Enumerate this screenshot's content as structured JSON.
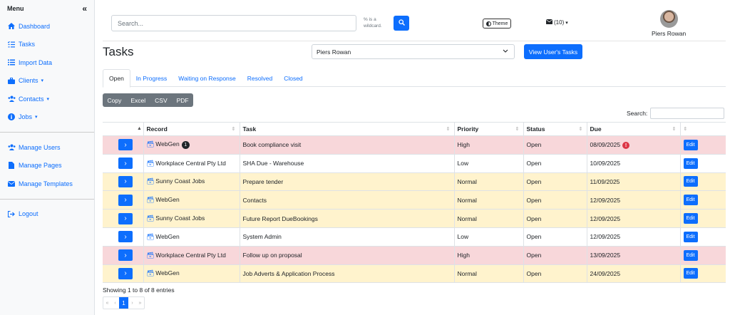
{
  "sidebar": {
    "title": "Menu",
    "collapse_icon": "«",
    "items": [
      {
        "label": "Dashboard",
        "icon": "home-icon"
      },
      {
        "label": "Tasks",
        "icon": "list-check-icon"
      },
      {
        "label": "Import Data",
        "icon": "list-icon"
      },
      {
        "label": "Clients",
        "icon": "briefcase-icon",
        "dropdown": true
      },
      {
        "label": "Contacts",
        "icon": "users-icon",
        "dropdown": true
      },
      {
        "label": "Jobs",
        "icon": "info-circle-icon",
        "dropdown": true
      }
    ],
    "admin_items": [
      {
        "label": "Manage Users",
        "icon": "users-icon"
      },
      {
        "label": "Manage Pages",
        "icon": "file-icon"
      },
      {
        "label": "Manage Templates",
        "icon": "envelope-icon"
      }
    ],
    "logout": {
      "label": "Logout",
      "icon": "logout-icon"
    }
  },
  "topbar": {
    "search_placeholder": "Search...",
    "wildcard_note_line1": "% is a",
    "wildcard_note_line2": "wildcard.",
    "theme_label": "Theme",
    "mail_label": "(10)",
    "user_name": "Piers Rowan"
  },
  "page": {
    "title": "Tasks",
    "user_select_value": "Piers Rowan",
    "view_tasks_label": "View User's Tasks"
  },
  "tabs": [
    "Open",
    "In Progress",
    "Waiting on Response",
    "Resolved",
    "Closed"
  ],
  "export_buttons": [
    "Copy",
    "Excel",
    "CSV",
    "PDF"
  ],
  "search_label": "Search:",
  "table": {
    "columns": [
      "",
      "Record",
      "Task",
      "Priority",
      "Status",
      "Due",
      ""
    ],
    "rows": [
      {
        "record": "WebGen",
        "badge": "1",
        "task": "Book compliance visit",
        "priority": "High",
        "status": "Open",
        "due": "08/09/2025",
        "overdue": "!",
        "edit": "Edit"
      },
      {
        "record": "Workplace Central Pty Ltd",
        "task": "SHA Due - Warehouse",
        "priority": "Low",
        "status": "Open",
        "due": "10/09/2025",
        "edit": "Edit"
      },
      {
        "record": "Sunny Coast Jobs",
        "task": "Prepare tender",
        "priority": "Normal",
        "status": "Open",
        "due": "11/09/2025",
        "edit": "Edit"
      },
      {
        "record": "WebGen",
        "task": "Contacts",
        "priority": "Normal",
        "status": "Open",
        "due": "12/09/2025",
        "edit": "Edit"
      },
      {
        "record": "Sunny Coast Jobs",
        "task": "Future Report DueBookings",
        "priority": "Normal",
        "status": "Open",
        "due": "12/09/2025",
        "edit": "Edit"
      },
      {
        "record": "WebGen",
        "task": "System Admin",
        "priority": "Low",
        "status": "Open",
        "due": "12/09/2025",
        "edit": "Edit"
      },
      {
        "record": "Workplace Central Pty Ltd",
        "task": "Follow up on proposal",
        "priority": "High",
        "status": "Open",
        "due": "13/09/2025",
        "edit": "Edit"
      },
      {
        "record": "WebGen",
        "task": "Job Adverts & Application Process",
        "priority": "Normal",
        "status": "Open",
        "due": "24/09/2025",
        "edit": "Edit"
      }
    ]
  },
  "footer": {
    "info": "Showing 1 to 8 of 8 entries",
    "pager": [
      "«",
      "‹",
      "1",
      "›",
      "»"
    ],
    "current_page": "1"
  }
}
